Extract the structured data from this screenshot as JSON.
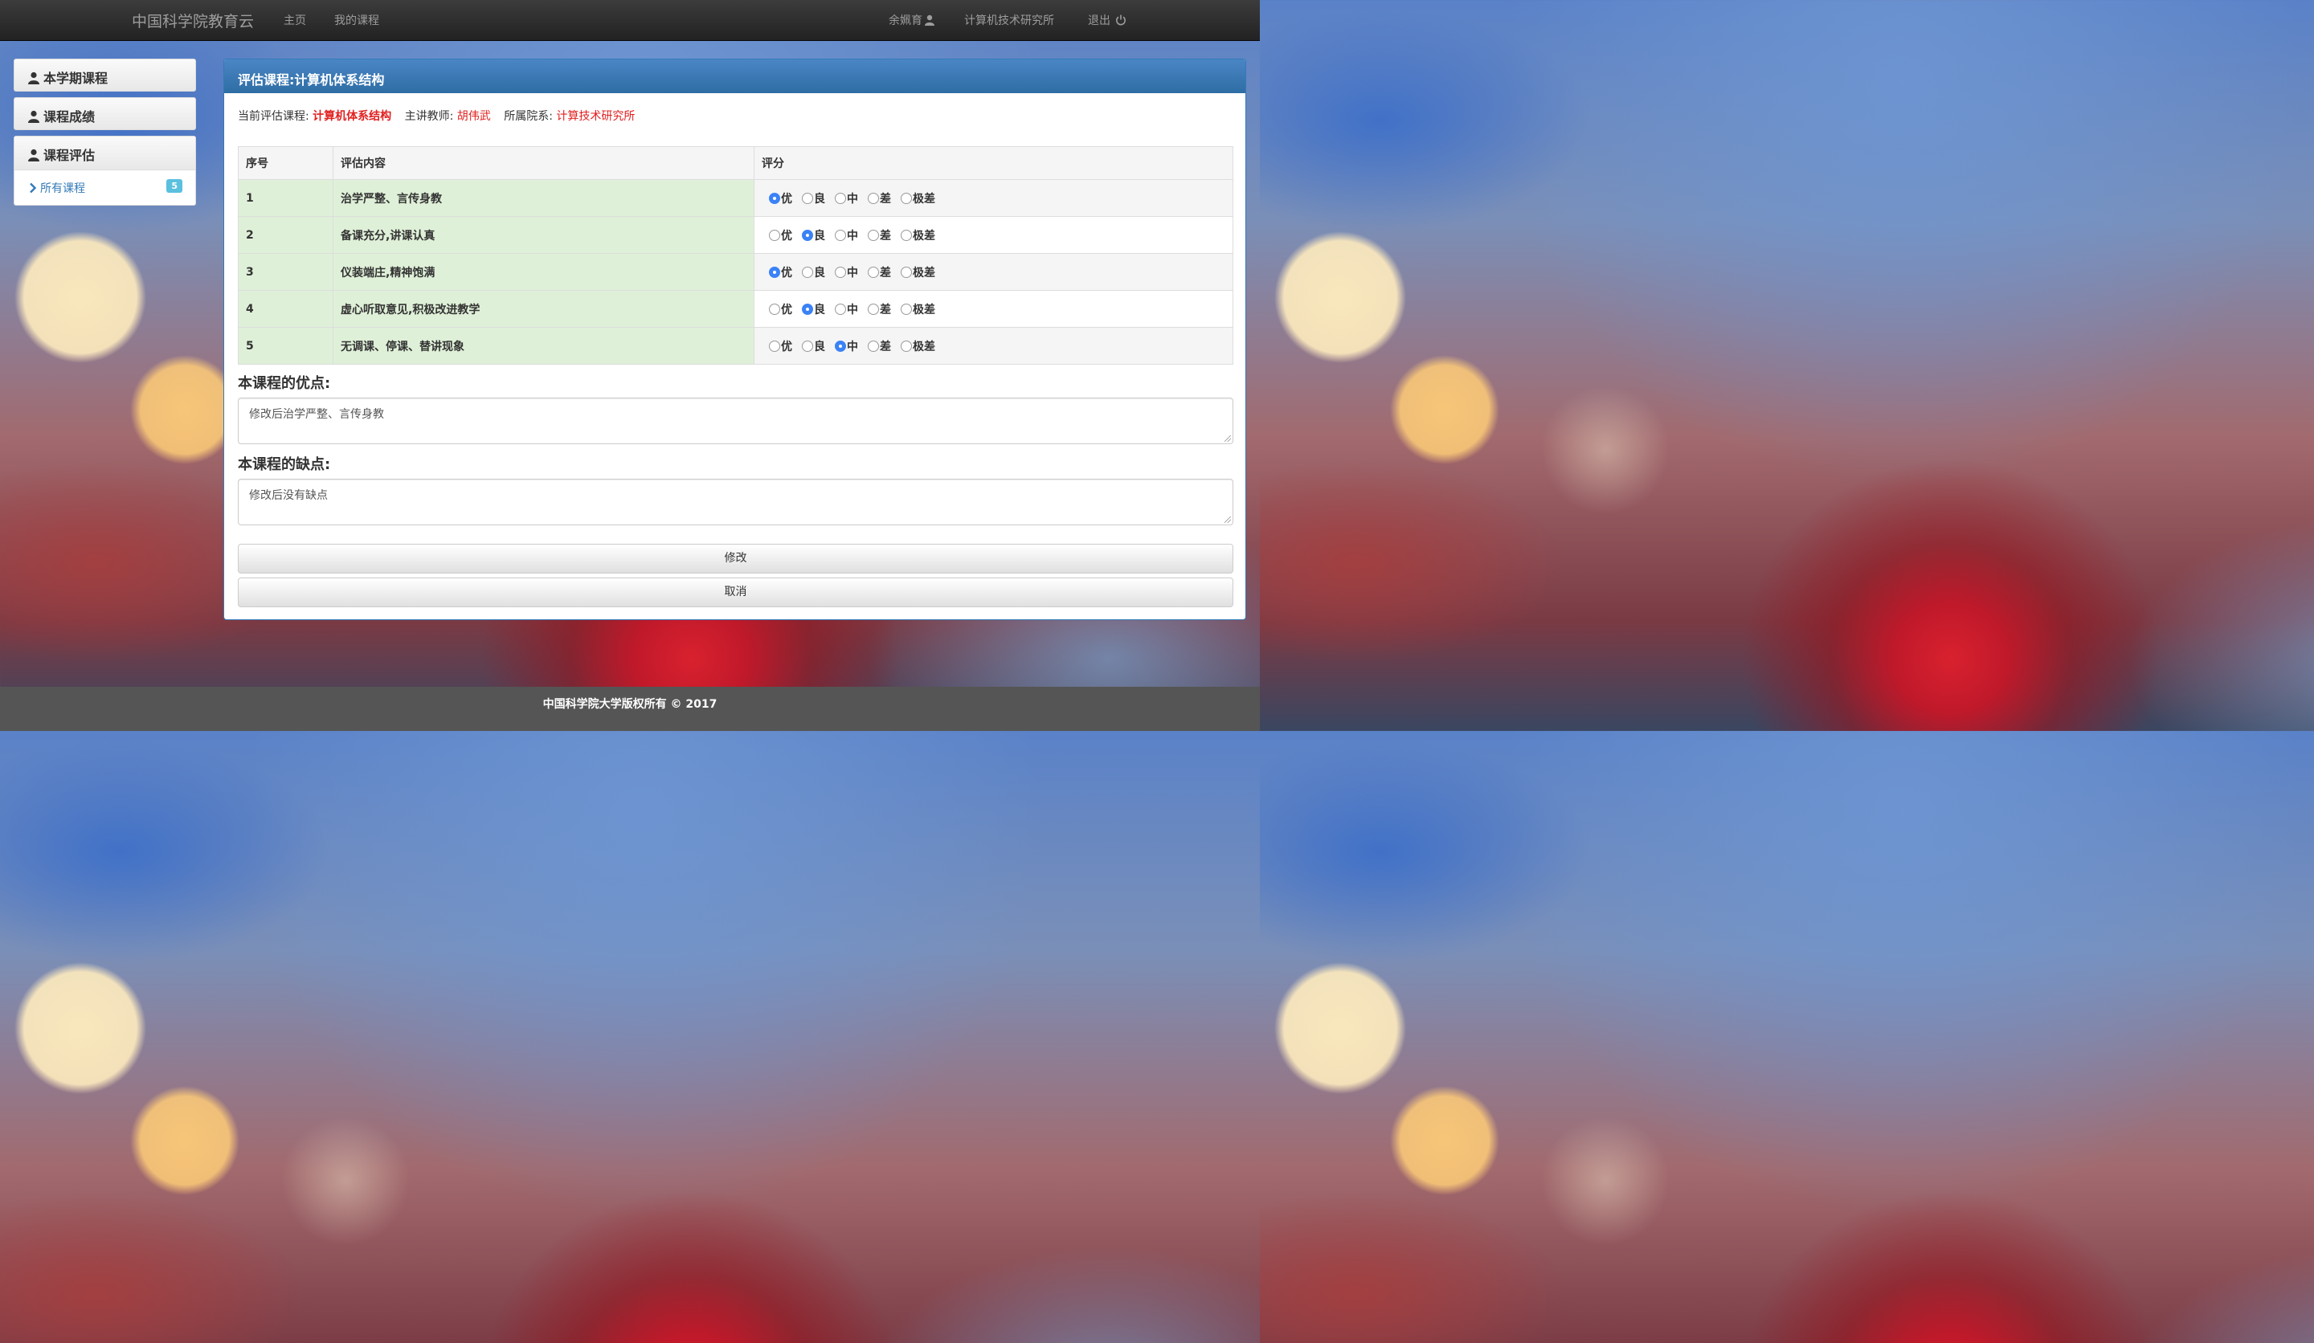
{
  "navbar": {
    "brand": "中国科学院教育云",
    "links": [
      "主页",
      "我的课程"
    ],
    "user_name": "余姵育",
    "institute": "计算机技术研究所",
    "logout": "退出"
  },
  "sidebar": {
    "items": [
      {
        "label": "本学期课程",
        "icon": "user-icon"
      },
      {
        "label": "课程成绩",
        "icon": "user-icon"
      }
    ],
    "group": {
      "label": "课程评估",
      "icon": "user-icon",
      "sub": {
        "label": "所有课程",
        "icon": "chevron-right-icon",
        "badge": "5"
      }
    }
  },
  "panel": {
    "title": "评估课程:计算机体系结构",
    "info": {
      "course_label": "当前评估课程:",
      "course_value": "计算机体系结构",
      "teacher_label": "主讲教师:",
      "teacher_value": "胡伟武",
      "dept_label": "所属院系:",
      "dept_value": "计算技术研究所"
    },
    "table": {
      "headers": [
        "序号",
        "评估内容",
        "评分"
      ],
      "options": [
        "优",
        "良",
        "中",
        "差",
        "极差"
      ],
      "rows": [
        {
          "no": "1",
          "content": "治学严整、言传身教",
          "selected": "优"
        },
        {
          "no": "2",
          "content": "备课充分,讲课认真",
          "selected": "良"
        },
        {
          "no": "3",
          "content": "仪装端庄,精神饱满",
          "selected": "优"
        },
        {
          "no": "4",
          "content": "虚心听取意见,积极改进教学",
          "selected": "良"
        },
        {
          "no": "5",
          "content": "无调课、停课、替讲现象",
          "selected": "中"
        }
      ]
    },
    "pros_label": "本课程的优点:",
    "pros_value": "修改后治学严整、言传身教",
    "cons_label": "本课程的缺点:",
    "cons_value": "修改后没有缺点",
    "modify_button": "修改",
    "cancel_button": "取消"
  },
  "footer": {
    "text": "中国科学院大学版权所有 © 2017"
  },
  "colors": {
    "navbar": "#222222",
    "panel_primary": "#337ab7",
    "highlight_red": "#e02020",
    "row_green": "#dff0d8",
    "badge": "#5bc0de",
    "radio_selected": "#3b82f6"
  }
}
